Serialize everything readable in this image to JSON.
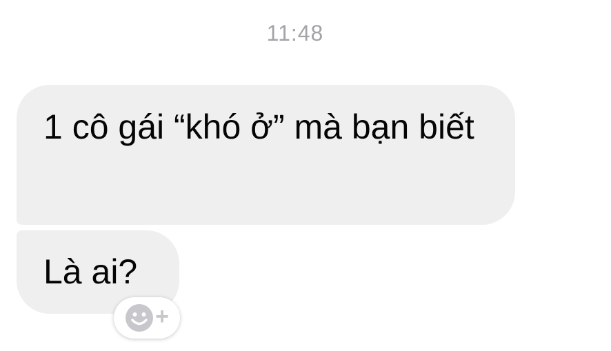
{
  "conversation": {
    "timestamp": "11:48",
    "messages": [
      {
        "text": "1 cô gái “khó ở” mà bạn biết"
      },
      {
        "text": "Là ai?"
      }
    ]
  },
  "reaction_button": {
    "icon": "smiley-add-reaction-icon",
    "plus_symbol": "+"
  },
  "colors": {
    "bubble_bg": "#efefef",
    "timestamp": "#a3a3a8",
    "text": "#050505",
    "reaction_icon": "#c8c8cc"
  }
}
